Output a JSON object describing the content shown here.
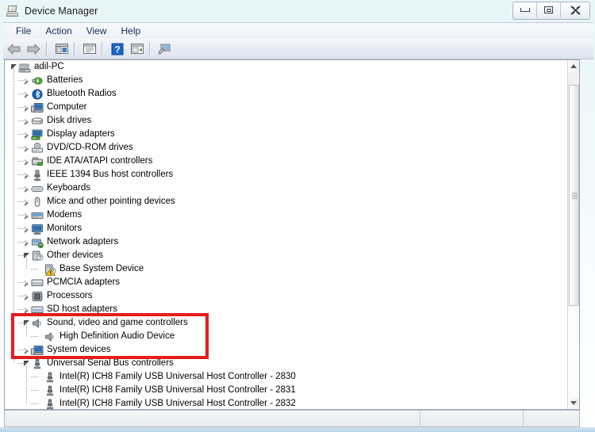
{
  "window": {
    "title": "Device Manager",
    "icon": "device-manager-icon",
    "controls": {
      "minimize": "Minimize",
      "maximize": "Maximize",
      "close": "Close"
    }
  },
  "menubar": {
    "items": [
      {
        "label": "File"
      },
      {
        "label": "Action"
      },
      {
        "label": "View"
      },
      {
        "label": "Help"
      }
    ]
  },
  "toolbar": {
    "buttons": [
      {
        "name": "back-button",
        "icon": "left-arrow-icon",
        "label": "Back"
      },
      {
        "name": "forward-button",
        "icon": "right-arrow-icon",
        "label": "Forward"
      },
      {
        "name": "show-hide-console-tree-button",
        "icon": "console-tree-icon",
        "label": "Show/Hide Console Tree"
      },
      {
        "name": "properties-button",
        "icon": "properties-icon",
        "label": "Properties"
      },
      {
        "name": "help-button",
        "icon": "help-question-icon",
        "label": "Help"
      },
      {
        "name": "scan-hardware-changes-button",
        "icon": "scan-icon",
        "label": "Scan for hardware changes"
      },
      {
        "name": "update-driver-button",
        "icon": "update-driver-icon",
        "label": "Update Driver Software"
      }
    ]
  },
  "tree": {
    "root": {
      "label": "adil-PC",
      "icon": "computer-root-icon",
      "state": "expanded",
      "indent": 0
    },
    "nodes": [
      {
        "label": "Batteries",
        "icon": "battery-icon",
        "state": "collapsed",
        "indent": 1,
        "warning": false
      },
      {
        "label": "Bluetooth Radios",
        "icon": "bluetooth-icon",
        "state": "collapsed",
        "indent": 1,
        "warning": false
      },
      {
        "label": "Computer",
        "icon": "computer-icon",
        "state": "collapsed",
        "indent": 1,
        "warning": false
      },
      {
        "label": "Disk drives",
        "icon": "disk-drive-icon",
        "state": "collapsed",
        "indent": 1,
        "warning": false
      },
      {
        "label": "Display adapters",
        "icon": "display-adapter-icon",
        "state": "collapsed",
        "indent": 1,
        "warning": false
      },
      {
        "label": "DVD/CD-ROM drives",
        "icon": "dvd-drive-icon",
        "state": "collapsed",
        "indent": 1,
        "warning": false
      },
      {
        "label": "IDE ATA/ATAPI controllers",
        "icon": "ide-controller-icon",
        "state": "collapsed",
        "indent": 1,
        "warning": false
      },
      {
        "label": "IEEE 1394 Bus host controllers",
        "icon": "ieee1394-icon",
        "state": "collapsed",
        "indent": 1,
        "warning": false
      },
      {
        "label": "Keyboards",
        "icon": "keyboard-icon",
        "state": "collapsed",
        "indent": 1,
        "warning": false
      },
      {
        "label": "Mice and other pointing devices",
        "icon": "mouse-icon",
        "state": "collapsed",
        "indent": 1,
        "warning": false
      },
      {
        "label": "Modems",
        "icon": "modem-icon",
        "state": "collapsed",
        "indent": 1,
        "warning": false
      },
      {
        "label": "Monitors",
        "icon": "monitor-icon",
        "state": "collapsed",
        "indent": 1,
        "warning": false
      },
      {
        "label": "Network adapters",
        "icon": "network-adapter-icon",
        "state": "collapsed",
        "indent": 1,
        "warning": false
      },
      {
        "label": "Other devices",
        "icon": "other-device-icon",
        "state": "expanded",
        "indent": 1,
        "warning": false
      },
      {
        "label": "Base System Device",
        "icon": "other-device-icon",
        "state": "leaf",
        "indent": 2,
        "warning": true
      },
      {
        "label": "PCMCIA adapters",
        "icon": "pcmcia-icon",
        "state": "collapsed",
        "indent": 1,
        "warning": false
      },
      {
        "label": "Processors",
        "icon": "processor-icon",
        "state": "collapsed",
        "indent": 1,
        "warning": false
      },
      {
        "label": "SD host adapters",
        "icon": "sd-host-icon",
        "state": "collapsed",
        "indent": 1,
        "warning": false
      },
      {
        "label": "Sound, video and game controllers",
        "icon": "sound-icon",
        "state": "expanded",
        "indent": 1,
        "warning": false
      },
      {
        "label": "High Definition Audio Device",
        "icon": "sound-icon",
        "state": "leaf",
        "indent": 2,
        "warning": false
      },
      {
        "label": "System devices",
        "icon": "system-device-icon",
        "state": "collapsed",
        "indent": 1,
        "warning": false
      },
      {
        "label": "Universal Serial Bus controllers",
        "icon": "usb-icon",
        "state": "expanded",
        "indent": 1,
        "warning": false
      },
      {
        "label": "Intel(R) ICH8 Family USB Universal Host Controller - 2830",
        "icon": "usb-icon",
        "state": "leaf",
        "indent": 2,
        "warning": false
      },
      {
        "label": "Intel(R) ICH8 Family USB Universal Host Controller - 2831",
        "icon": "usb-icon",
        "state": "leaf",
        "indent": 2,
        "warning": false
      },
      {
        "label": "Intel(R) ICH8 Family USB Universal Host Controller - 2832",
        "icon": "usb-icon",
        "state": "leaf",
        "indent": 2,
        "warning": false
      }
    ]
  },
  "annotation": {
    "highlight_color": "#e71b1b",
    "highlight_target": "Sound, video and game controllers"
  },
  "statusbar": {
    "panels": [
      "",
      "",
      ""
    ]
  },
  "scrollbar": {
    "orientation": "vertical",
    "thumb_top_pct": 4,
    "thumb_height_pct": 68
  }
}
